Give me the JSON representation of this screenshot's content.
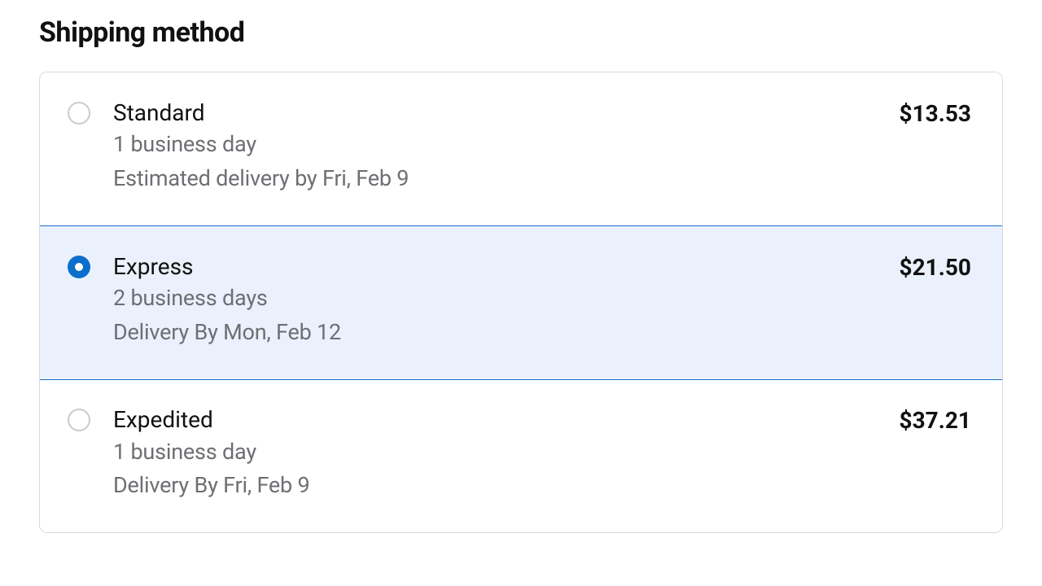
{
  "section": {
    "title": "Shipping method"
  },
  "options": [
    {
      "name": "Standard",
      "duration": "1 business day",
      "delivery": "Estimated delivery by Fri, Feb 9",
      "price": "$13.53",
      "selected": false
    },
    {
      "name": "Express",
      "duration": "2 business days",
      "delivery": "Delivery By Mon, Feb 12",
      "price": "$21.50",
      "selected": true
    },
    {
      "name": "Expedited",
      "duration": "1 business day",
      "delivery": "Delivery By Fri, Feb 9",
      "price": "$37.21",
      "selected": false
    }
  ]
}
